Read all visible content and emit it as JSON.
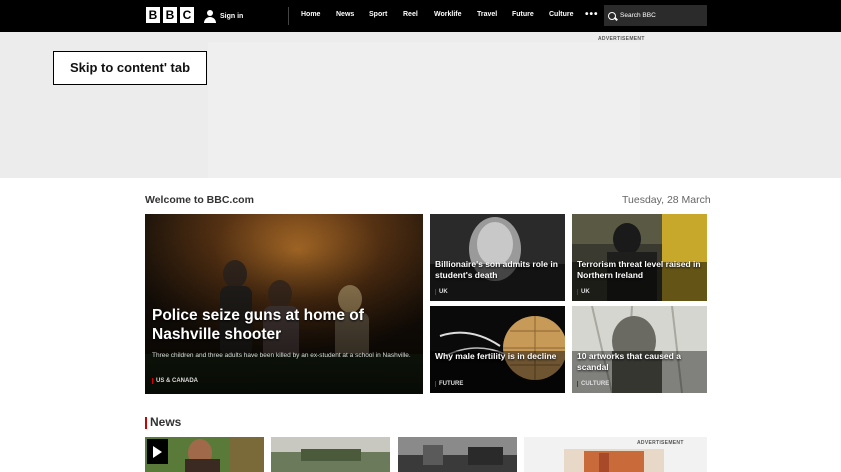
{
  "header": {
    "logo_letters": [
      "B",
      "B",
      "C"
    ],
    "signin": "Sign in",
    "nav": [
      "Home",
      "News",
      "Sport",
      "Reel",
      "Worklife",
      "Travel",
      "Future",
      "Culture"
    ],
    "more": "•••",
    "search_placeholder": "Search BBC"
  },
  "ad_labels": {
    "top": "ADVERTISEMENT",
    "bottom": "ADVERTISEMENT"
  },
  "skip_link": "Skip to content' tab",
  "section": {
    "welcome": "Welcome to BBC.com",
    "date": "Tuesday, 28 March"
  },
  "lead": {
    "title": "Police seize guns at home of Nashville shooter",
    "summary": "Three children and three adults have been killed by an ex-student at a school in Nashville.",
    "tag": "US & CANADA"
  },
  "cards": [
    {
      "title": "Billionaire's son admits role in student's death",
      "tag": "UK"
    },
    {
      "title": "Terrorism threat level raised in Northern Ireland",
      "tag": "UK"
    },
    {
      "title": "Why male fertility is in decline",
      "tag": "FUTURE"
    },
    {
      "title": "10 artworks that caused a scandal",
      "tag": "CULTURE"
    }
  ],
  "news_heading": "News",
  "colors": {
    "nav_bg": "#000000",
    "accent_red": "#cc0000",
    "ad_bg": "#ececec"
  }
}
